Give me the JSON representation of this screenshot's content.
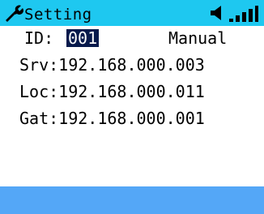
{
  "header": {
    "title": "Setting",
    "icons": [
      "wrench-icon",
      "volume-icon",
      "signal-icon"
    ],
    "background_color": "#1ec8f0"
  },
  "settings": {
    "id_label": "ID:",
    "id_value": "001",
    "mode": "Manual",
    "server": "Srv:192.168.000.003",
    "local": "Loc:192.168.000.011",
    "gateway": "Gat:192.168.000.001",
    "selection_color": "#071a4c"
  },
  "footer": {
    "background_color": "#54a7f7"
  }
}
